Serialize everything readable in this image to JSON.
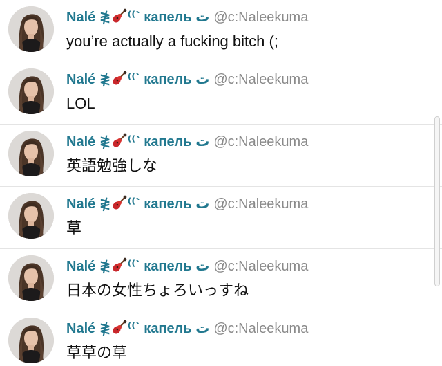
{
  "feed": {
    "posts": [
      {
        "name_prefix": "Nalé ≹",
        "name_suffix": "⁽⁽ˋ капель ت",
        "handle": "@c:Naleekuma",
        "text": "you’re actually a fucking bitch (;"
      },
      {
        "name_prefix": "Nalé ≹",
        "name_suffix": "⁽⁽ˋ капель ت",
        "handle": "@c:Naleekuma",
        "text": "LOL"
      },
      {
        "name_prefix": "Nalé ≹",
        "name_suffix": "⁽⁽ˋ капель ت",
        "handle": "@c:Naleekuma",
        "text": "英語勉強しな"
      },
      {
        "name_prefix": "Nalé ≹",
        "name_suffix": "⁽⁽ˋ капель ت",
        "handle": "@c:Naleekuma",
        "text": "草"
      },
      {
        "name_prefix": "Nalé ≹",
        "name_suffix": "⁽⁽ˋ капель ت",
        "handle": "@c:Naleekuma",
        "text": "日本の女性ちょろいっすね"
      },
      {
        "name_prefix": "Nalé ≹",
        "name_suffix": "⁽⁽ˋ капель ت",
        "handle": "@c:Naleekuma",
        "text": "草草の草"
      }
    ],
    "name_icon": "guitar-icon"
  },
  "colors": {
    "display_name": "#21788f",
    "handle": "#8a8a8a",
    "post_text": "#111111",
    "divider": "#e4e4e4"
  }
}
